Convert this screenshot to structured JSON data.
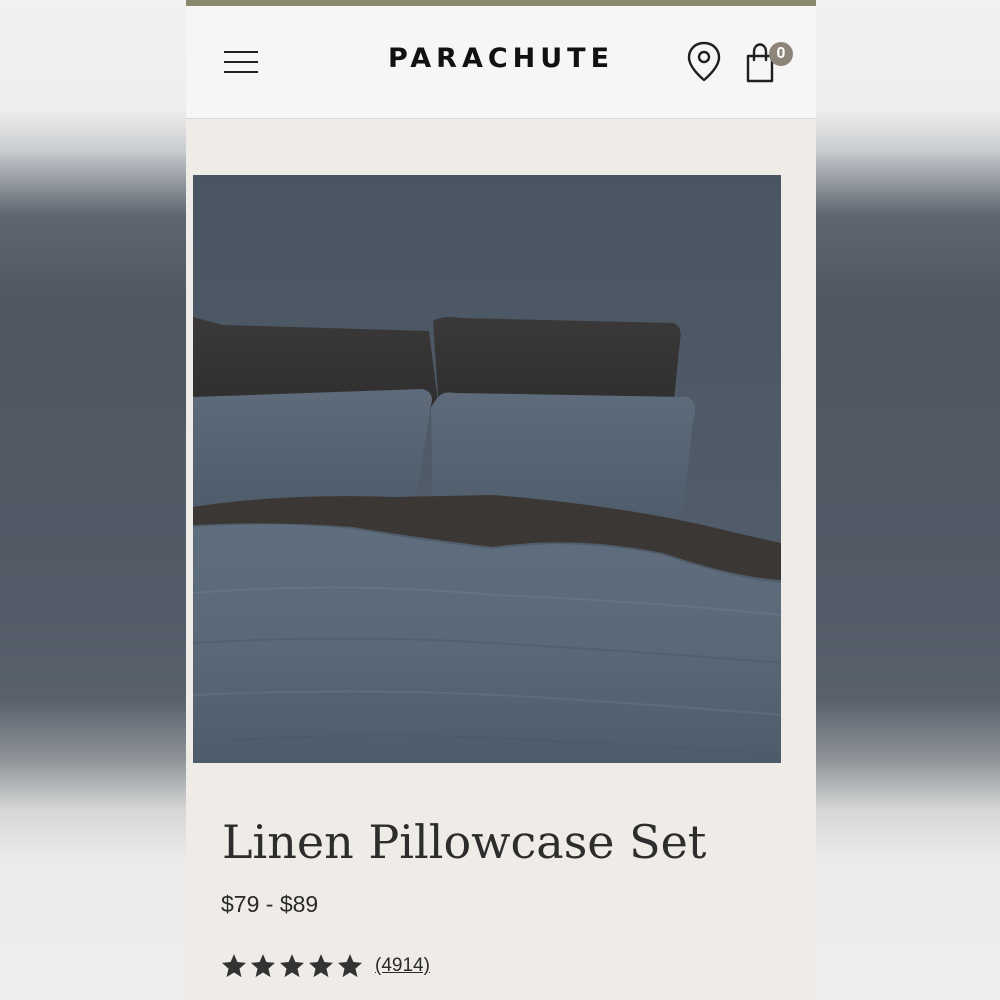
{
  "header": {
    "brand": "PARACHUTE",
    "menu_icon": "hamburger-menu-icon",
    "location_icon": "map-pin-icon",
    "cart_icon": "shopping-bag-icon",
    "cart_count": "0"
  },
  "product": {
    "image_alt": "bedding",
    "title": "Linen Pillowcase Set",
    "price": "$79 - $89",
    "rating": 5,
    "review_count": "(4914)"
  },
  "colors": {
    "accent_stripe": "#87886e",
    "badge": "#8e857a",
    "page_background": "#efece7",
    "header_background": "#f6f6f6"
  }
}
